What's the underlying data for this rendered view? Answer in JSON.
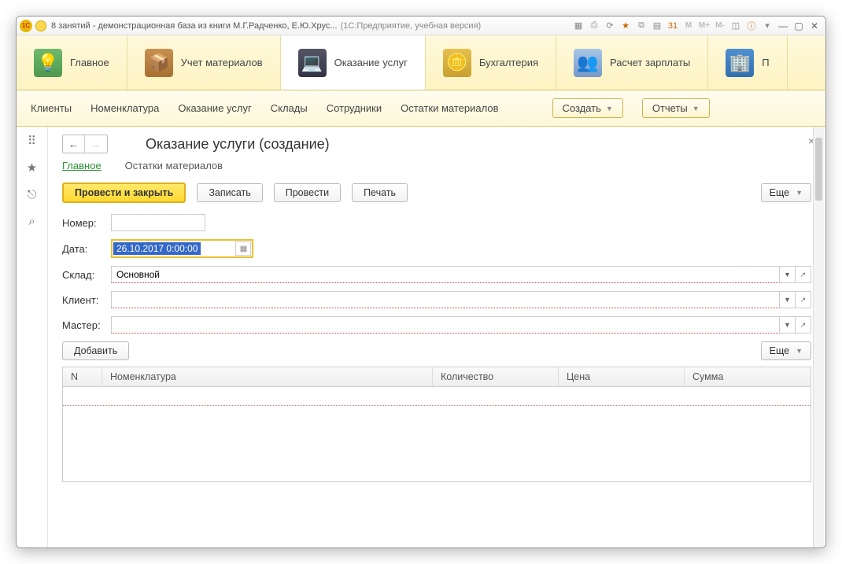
{
  "titlebar": {
    "title": "8 занятий - демонстрационная база из книги М.Г.Радченко, Е.Ю.Хрус...",
    "app": "(1С:Предприятие, учебная версия)"
  },
  "sections": [
    {
      "label": "Главное"
    },
    {
      "label": "Учет материалов"
    },
    {
      "label": "Оказание услуг"
    },
    {
      "label": "Бухгалтерия"
    },
    {
      "label": "Расчет зарплаты"
    },
    {
      "label": "П"
    }
  ],
  "subnav": {
    "links": [
      "Клиенты",
      "Номенклатура",
      "Оказание услуг",
      "Склады",
      "Сотрудники",
      "Остатки материалов"
    ],
    "create": "Создать",
    "reports": "Отчеты"
  },
  "page": {
    "title": "Оказание услуги (создание)",
    "tabs": [
      "Главное",
      "Остатки материалов"
    ],
    "toolbar": {
      "post_close": "Провести и закрыть",
      "save": "Записать",
      "post": "Провести",
      "print": "Печать",
      "more": "Еще"
    },
    "fields": {
      "number_label": "Номер:",
      "number_value": "",
      "date_label": "Дата:",
      "date_value": "26.10.2017  0:00:00",
      "warehouse_label": "Склад:",
      "warehouse_value": "Основной",
      "client_label": "Клиент:",
      "client_value": "",
      "master_label": "Мастер:",
      "master_value": ""
    },
    "tbl_toolbar": {
      "add": "Добавить",
      "more": "Еще"
    },
    "table": {
      "cols": {
        "n": "N",
        "nom": "Номенклатура",
        "qty": "Количество",
        "price": "Цена",
        "sum": "Сумма"
      }
    }
  }
}
